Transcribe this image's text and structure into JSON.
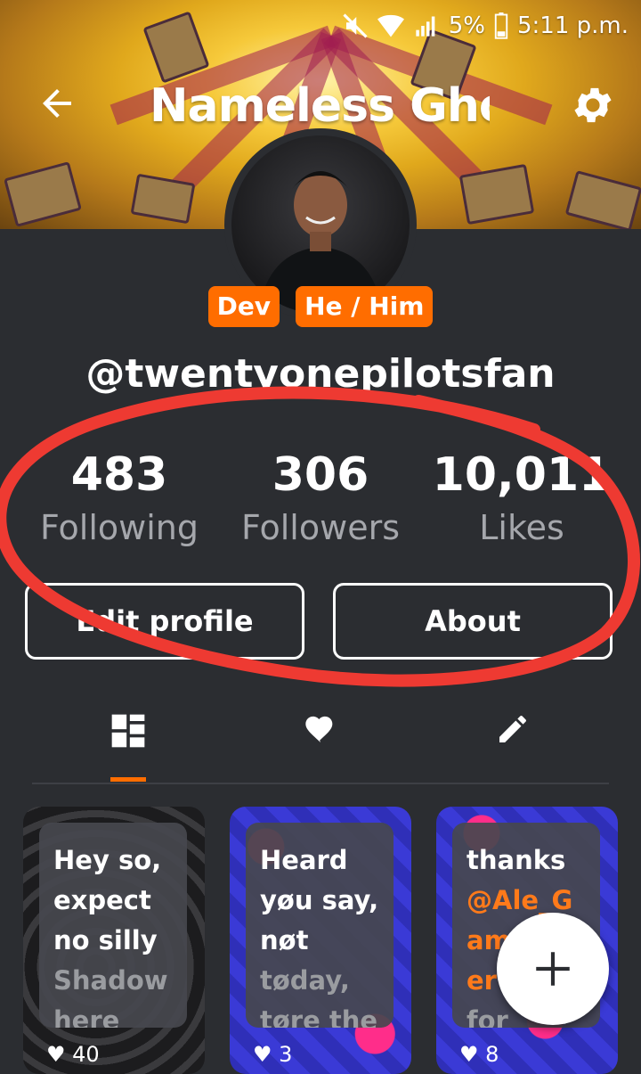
{
  "status_bar": {
    "battery": "5%",
    "time": "5:11 p.m."
  },
  "header": {
    "title": "Nameless Gho"
  },
  "profile": {
    "badges": [
      "Dev",
      "He / Him"
    ],
    "username": "@twentyonepilotsfan"
  },
  "stats": [
    {
      "value": "483",
      "label": "Following"
    },
    {
      "value": "306",
      "label": "Followers"
    },
    {
      "value": "10,011",
      "label": "Likes"
    }
  ],
  "actions": {
    "edit_profile": "Edit profile",
    "about": "About"
  },
  "tabs": [
    "posts-grid-icon",
    "heart-icon",
    "pencil-icon"
  ],
  "cards": [
    {
      "line1": "Hey so,",
      "line2": "expect",
      "line3": "no silly",
      "line4": "Shadow",
      "line5": "here",
      "likes": "40"
    },
    {
      "line1": "Heard",
      "line2": "yøu say,",
      "line3": "nøt",
      "line4": "tøday,",
      "line5": "tøre the",
      "likes": "3"
    },
    {
      "line1": "thanks",
      "line2": "@Ale_G",
      "line3": "am",
      "line4": "er",
      "line5": "for",
      "likes": "8"
    }
  ],
  "colors": {
    "accent": "#ff6d00",
    "background": "#2b2d31",
    "annotation": "#ee3a32"
  }
}
